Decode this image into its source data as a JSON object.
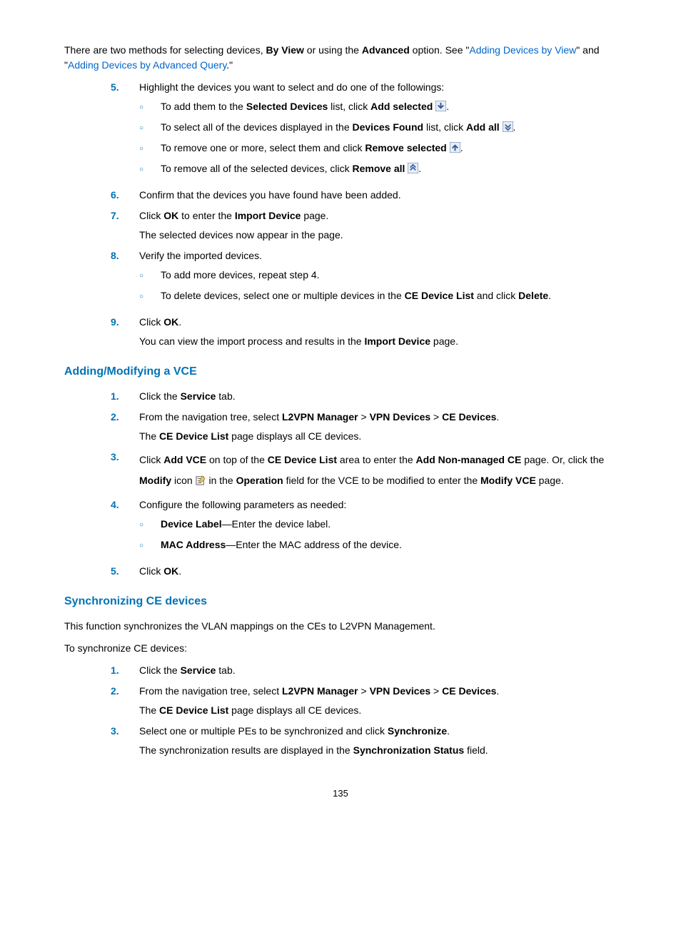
{
  "intro": {
    "pre": "There are two methods for selecting devices, ",
    "b1": "By View",
    "mid1": " or using the ",
    "b2": "Advanced",
    "mid2": " option. See \"",
    "link1": "Adding Devices by View",
    "mid3": "\" and \"",
    "link2": "Adding Devices by Advanced Query",
    "post": ".\""
  },
  "s5": {
    "num": "5.",
    "lead": "Highlight the devices you want to select and do one of the followings:",
    "a": {
      "pre": "To add them to the ",
      "b1": "Selected Devices",
      "mid": " list, click ",
      "b2": "Add selected",
      "post": "."
    },
    "b": {
      "pre": "To select all of the devices displayed in the ",
      "b1": "Devices Found",
      "mid": " list, click ",
      "b2": "Add all",
      "post": "."
    },
    "c": {
      "pre": "To remove one or more, select them and click ",
      "b1": "Remove selected",
      "post": "."
    },
    "d": {
      "pre": "To remove all of the selected devices, click ",
      "b1": "Remove all",
      "post": "."
    }
  },
  "s6": {
    "num": "6.",
    "t": "Confirm that the devices you have found have been added."
  },
  "s7": {
    "num": "7.",
    "p1a": "Click ",
    "p1b": "OK",
    "p1c": " to enter the ",
    "p1d": "Import Device",
    "p1e": " page.",
    "p2": "The selected devices now appear in the page."
  },
  "s8": {
    "num": "8.",
    "lead": "Verify the imported devices.",
    "a": "To add more devices, repeat step 4.",
    "b": {
      "pre": "To delete devices, select one or multiple devices in the ",
      "b1": "CE Device List",
      "mid": " and click ",
      "b2": "Delete",
      "post": "."
    }
  },
  "s9": {
    "num": "9.",
    "p1a": "Click ",
    "p1b": "OK",
    "p1c": ".",
    "p2a": "You can view the import process and results in the ",
    "p2b": "Import Device",
    "p2c": " page."
  },
  "h1": "Adding/Modifying a VCE",
  "v1": {
    "num": "1.",
    "a": "Click the ",
    "b": "Service",
    "c": " tab."
  },
  "v2": {
    "num": "2.",
    "a": "From the navigation tree, select ",
    "b": "L2VPN Manager",
    "c": " > ",
    "d": "VPN Devices",
    "e": " > ",
    "f": "CE Devices",
    "g": ".",
    "p2a": "The ",
    "p2b": "CE Device List",
    "p2c": " page displays all CE devices."
  },
  "v3": {
    "num": "3.",
    "a": "Click ",
    "b": "Add VCE",
    "c": " on top of the ",
    "d": "CE Device List",
    "e": " area to enter the ",
    "f": "Add Non-managed CE",
    "g": " page. Or, click the ",
    "h": "Modify",
    "i": " icon ",
    "j": " in the ",
    "k": "Operation",
    "l": " field for the VCE to be modified to enter the ",
    "m": "Modify VCE",
    "n": " page."
  },
  "v4": {
    "num": "4.",
    "lead": "Configure the following parameters as needed:",
    "a": {
      "b": "Device Label",
      "t": "—Enter the device label."
    },
    "b": {
      "b": "MAC Address",
      "t": "—Enter the MAC address of the device."
    }
  },
  "v5": {
    "num": "5.",
    "a": "Click ",
    "b": "OK",
    "c": "."
  },
  "h2": "Synchronizing CE devices",
  "sync_intro": "This function synchronizes the VLAN mappings on the CEs to L2VPN Management.",
  "sync_lead": "To synchronize CE devices:",
  "y1": {
    "num": "1.",
    "a": "Click the ",
    "b": "Service",
    "c": " tab."
  },
  "y2": {
    "num": "2.",
    "a": "From the navigation tree, select ",
    "b": "L2VPN Manager",
    "c": " > ",
    "d": "VPN Devices",
    "e": " > ",
    "f": "CE Devices",
    "g": ".",
    "p2a": "The ",
    "p2b": "CE Device List",
    "p2c": " page displays all CE devices."
  },
  "y3": {
    "num": "3.",
    "a": "Select one or multiple PEs to be synchronized and click ",
    "b": "Synchronize",
    "c": ".",
    "p2a": "The synchronization results are displayed in the ",
    "p2b": "Synchronization Status",
    "p2c": " field."
  },
  "page_number": "135"
}
